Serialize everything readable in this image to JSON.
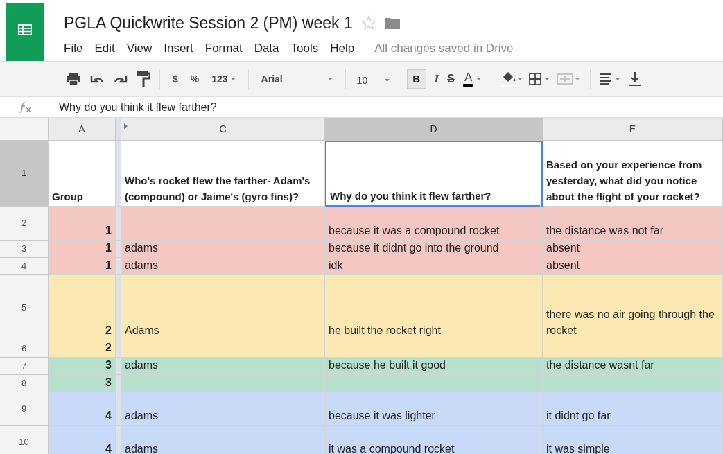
{
  "title": "PGLA Quickwrite Session 2 (PM) week 1",
  "menu": [
    "File",
    "Edit",
    "View",
    "Insert",
    "Format",
    "Data",
    "Tools",
    "Help"
  ],
  "save_status": "All changes saved in Drive",
  "toolbar": {
    "currency": "$",
    "percent": "%",
    "more_formats": "123",
    "font": "Arial",
    "font_size": "10",
    "bold": "B",
    "italic": "I",
    "strike": "S",
    "text_color": "A"
  },
  "formula_bar": {
    "value": "Why do you think it flew farther?"
  },
  "columns": [
    {
      "letter": "A",
      "selected": false
    },
    {
      "letter": "C",
      "selected": false
    },
    {
      "letter": "D",
      "selected": true
    },
    {
      "letter": "E",
      "selected": false
    }
  ],
  "rows": [
    {
      "number": "1",
      "selected": true,
      "cells": [
        "Group",
        "Who's rocket flew the farther- Adam's (compound) or Jaime's (gyro fins)?",
        "Why do you think it flew farther?",
        "Based on your experience from yesterday, what did you notice about the flight of your rocket?"
      ]
    },
    {
      "number": "2",
      "selected": false,
      "color": "#f4c7c3",
      "cells": [
        "1",
        "",
        "because it was a compound rocket",
        "the distance was not far"
      ]
    },
    {
      "number": "3",
      "selected": false,
      "color": "#f4c7c3",
      "cells": [
        "1",
        "adams",
        "because it didnt go into the ground",
        "absent"
      ]
    },
    {
      "number": "4",
      "selected": false,
      "color": "#f4c7c3",
      "cells": [
        "1",
        "adams",
        "idk",
        "absent"
      ]
    },
    {
      "number": "5",
      "selected": false,
      "color": "#fce8b2",
      "cells": [
        "2",
        "Adams",
        "he built the rocket right",
        "there was no air going through the rocket"
      ]
    },
    {
      "number": "6",
      "selected": false,
      "color": "#fce8b2",
      "cells": [
        "2",
        "",
        "",
        ""
      ]
    },
    {
      "number": "7",
      "selected": false,
      "color": "#b7e1cd",
      "cells": [
        "3",
        "adams",
        "because he built it good",
        "the distance wasnt far"
      ]
    },
    {
      "number": "8",
      "selected": false,
      "color": "#b7e1cd",
      "cells": [
        "3",
        "",
        "",
        ""
      ]
    },
    {
      "number": "9",
      "selected": false,
      "color": "#c9daf8",
      "cells": [
        "4",
        "adams",
        "because it was lighter",
        "it didnt go far"
      ]
    },
    {
      "number": "10",
      "selected": false,
      "color": "#c9daf8",
      "cells": [
        "4",
        "adams",
        "it was a compound rocket",
        "it was simple"
      ]
    }
  ]
}
